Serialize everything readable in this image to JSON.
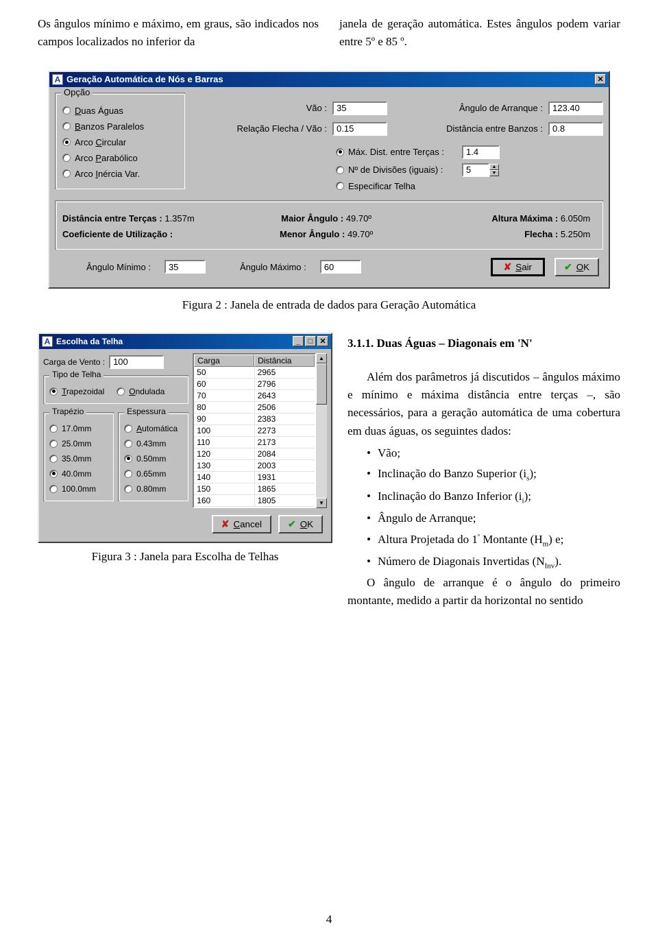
{
  "intro": {
    "left": "Os ângulos mínimo e máximo, em graus, são indicados nos campos localizados no inferior da",
    "right": "janela de geração automática. Estes ângulos podem variar entre 5º e 85 º."
  },
  "dlg1": {
    "title": "Geração Automática de Nós e Barras",
    "appicon_letter": "A",
    "opcao": {
      "title": "Opção",
      "items": [
        {
          "label_pre": "",
          "underline": "D",
          "label_post": "uas Águas",
          "checked": false
        },
        {
          "label_pre": "",
          "underline": "B",
          "label_post": "anzos Paralelos",
          "checked": false
        },
        {
          "label_pre": "Arco ",
          "underline": "C",
          "label_post": "ircular",
          "checked": true
        },
        {
          "label_pre": "Arco ",
          "underline": "P",
          "label_post": "arabólico",
          "checked": false
        },
        {
          "label_pre": "Arco ",
          "underline": "I",
          "label_post": "nércia Var.",
          "checked": false
        }
      ]
    },
    "params": {
      "vao_label": "Vão :",
      "vao_value": "35",
      "ang_arranque_label": "Ângulo de Arranque :",
      "ang_arranque_value": "123.40",
      "rel_label": "Relação Flecha / Vão :",
      "rel_value": "0.15",
      "dist_banzos_label": "Distância entre Banzos :",
      "dist_banzos_value": "0.8",
      "opt_max_label": "Máx. Dist. entre Terças :",
      "opt_max_value": "1.4",
      "opt_div_label": "Nº de Divisões (iguais) :",
      "opt_div_value": "5",
      "opt_telha_label": "Especificar Telha"
    },
    "status": {
      "l1": "Distância entre Terças :",
      "v1": "1.357m",
      "l2": "Maior Ângulo :",
      "v2": "49.70º",
      "l3": "Altura Máxima :",
      "v3": "6.050m",
      "l4": "Coeficiente de Utilização :",
      "v4": "",
      "l5": "Menor Ângulo :",
      "v5": "49.70º",
      "l6": "Flecha :",
      "v6": "5.250m"
    },
    "bottom": {
      "min_label": "Ângulo Mínimo :",
      "min_value": "35",
      "max_label": "Ângulo Máximo :",
      "max_value": "60",
      "sair_pre": "",
      "sair_u": "S",
      "sair_post": "air",
      "ok_pre": "",
      "ok_u": "O",
      "ok_post": "K"
    }
  },
  "figcaption2": "Figura 2 : Janela de entrada de dados para Geração Automática",
  "section311": {
    "heading": "3.1.1.   Duas Águas – Diagonais em 'N'",
    "para": "Além dos parâmetros já discutidos – ângulos máximo e mínimo e máxima distância entre terças –, são necessários, para a geração automática de uma cobertura em duas águas, os seguintes dados:",
    "bullets": [
      "Vão;",
      "Inclinação do Banzo Superior (i<sub>s</sub>);",
      "Inclinação do Banzo Inferior (i<sub>i</sub>);",
      "Ângulo de Arranque;",
      "Altura Projetada do 1<sup>º</sup> Montante (H<sub>m</sub>) e;",
      "Número de Diagonais Invertidas (N<sub>Inv</sub>)."
    ],
    "para2": "O ângulo de arranque é o ângulo do primeiro montante, medido a partir da horizontal no sentido"
  },
  "dlg2": {
    "title": "Escolha da Telha",
    "carga_label": "Carga de Vento :",
    "carga_value": "100",
    "tipo_title": "Tipo de Telha",
    "tipo_trap_u": "T",
    "tipo_trap_post": "rapezoidal",
    "tipo_ond_u": "O",
    "tipo_ond_post": "ndulada",
    "trap_title": "Trapézio",
    "trap_opts": [
      "17.0mm",
      "25.0mm",
      "35.0mm",
      "40.0mm",
      "100.0mm"
    ],
    "trap_checked": 3,
    "esp_title": "Espessura",
    "esp_u": "A",
    "esp_post": "utomática",
    "esp_opts": [
      "0.43mm",
      "0.50mm",
      "0.65mm",
      "0.80mm"
    ],
    "esp_checked": 1,
    "cancel_u": "C",
    "cancel_post": "ancel",
    "ok_u": "O",
    "ok_post": "K",
    "chart_data": {
      "type": "table",
      "columns": [
        "Carga",
        "Distância"
      ],
      "rows": [
        [
          50,
          2965
        ],
        [
          60,
          2796
        ],
        [
          70,
          2643
        ],
        [
          80,
          2506
        ],
        [
          90,
          2383
        ],
        [
          100,
          2273
        ],
        [
          110,
          2173
        ],
        [
          120,
          2084
        ],
        [
          130,
          2003
        ],
        [
          140,
          1931
        ],
        [
          150,
          1865
        ],
        [
          160,
          1805
        ]
      ]
    }
  },
  "figcaption3": "Figura 3 : Janela para Escolha de Telhas",
  "pagenum": "4"
}
